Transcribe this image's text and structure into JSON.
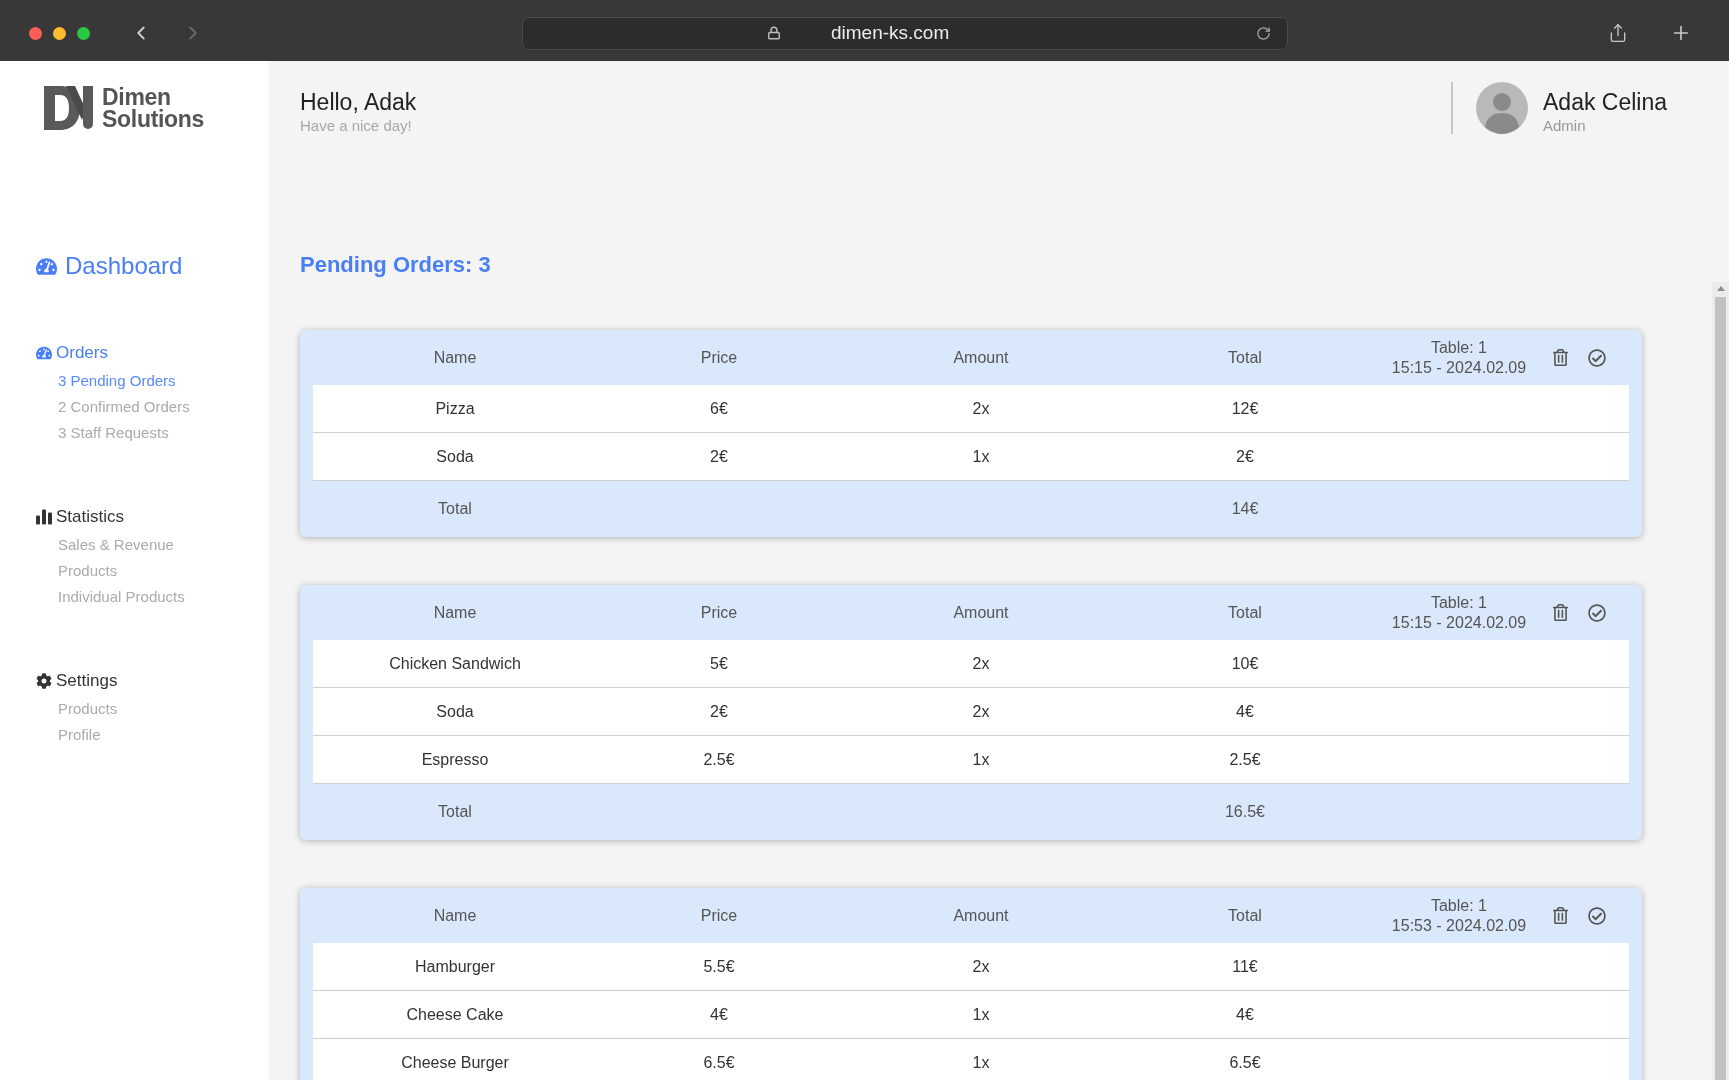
{
  "browser": {
    "url": "dimen-ks.com"
  },
  "sidebar": {
    "logo": [
      "Dimen",
      "Solutions"
    ],
    "dashboard": {
      "label": "Dashboard",
      "selected": true
    },
    "sections": [
      {
        "kind": "orders",
        "title": "Orders",
        "selected": true,
        "items": [
          {
            "label": "3 Pending Orders",
            "selected": true
          },
          {
            "label": "2 Confirmed Orders",
            "selected": false
          },
          {
            "label": "3 Staff Requests",
            "selected": false
          }
        ]
      },
      {
        "kind": "statistics",
        "title": "Statistics",
        "selected": false,
        "items": [
          {
            "label": "Sales & Revenue",
            "selected": false
          },
          {
            "label": "Products",
            "selected": false
          },
          {
            "label": "Individual Products",
            "selected": false
          }
        ]
      },
      {
        "kind": "settings",
        "title": "Settings",
        "selected": false,
        "items": [
          {
            "label": "Products",
            "selected": false
          },
          {
            "label": "Profile",
            "selected": false
          }
        ]
      }
    ]
  },
  "header": {
    "greeting": "Hello, Adak",
    "subtitle": "Have a nice day!",
    "user": {
      "name": "Adak Celina",
      "role": "Admin"
    }
  },
  "page_title": "Pending Orders: 3",
  "orders": [
    {
      "columns": [
        "Name",
        "Price",
        "Amount",
        "Total"
      ],
      "table": "Table: 1",
      "time": "15:15 - 2024.02.09",
      "items": [
        {
          "name": "Pizza",
          "price": "6€",
          "amount": "2x",
          "total": "12€"
        },
        {
          "name": "Soda",
          "price": "2€",
          "amount": "1x",
          "total": "2€"
        }
      ],
      "footer": {
        "label": "Total",
        "total": "14€"
      }
    },
    {
      "columns": [
        "Name",
        "Price",
        "Amount",
        "Total"
      ],
      "table": "Table: 1",
      "time": "15:15 - 2024.02.09",
      "items": [
        {
          "name": "Chicken Sandwich",
          "price": "5€",
          "amount": "2x",
          "total": "10€"
        },
        {
          "name": "Soda",
          "price": "2€",
          "amount": "2x",
          "total": "4€"
        },
        {
          "name": "Espresso",
          "price": "2.5€",
          "amount": "1x",
          "total": "2.5€"
        }
      ],
      "footer": {
        "label": "Total",
        "total": "16.5€"
      }
    },
    {
      "columns": [
        "Name",
        "Price",
        "Amount",
        "Total"
      ],
      "table": "Table: 1",
      "time": "15:53 - 2024.02.09",
      "items": [
        {
          "name": "Hamburger",
          "price": "5.5€",
          "amount": "2x",
          "total": "11€"
        },
        {
          "name": "Cheese Cake",
          "price": "4€",
          "amount": "1x",
          "total": "4€"
        },
        {
          "name": "Cheese Burger",
          "price": "6.5€",
          "amount": "1x",
          "total": "6.5€"
        }
      ]
    }
  ]
}
